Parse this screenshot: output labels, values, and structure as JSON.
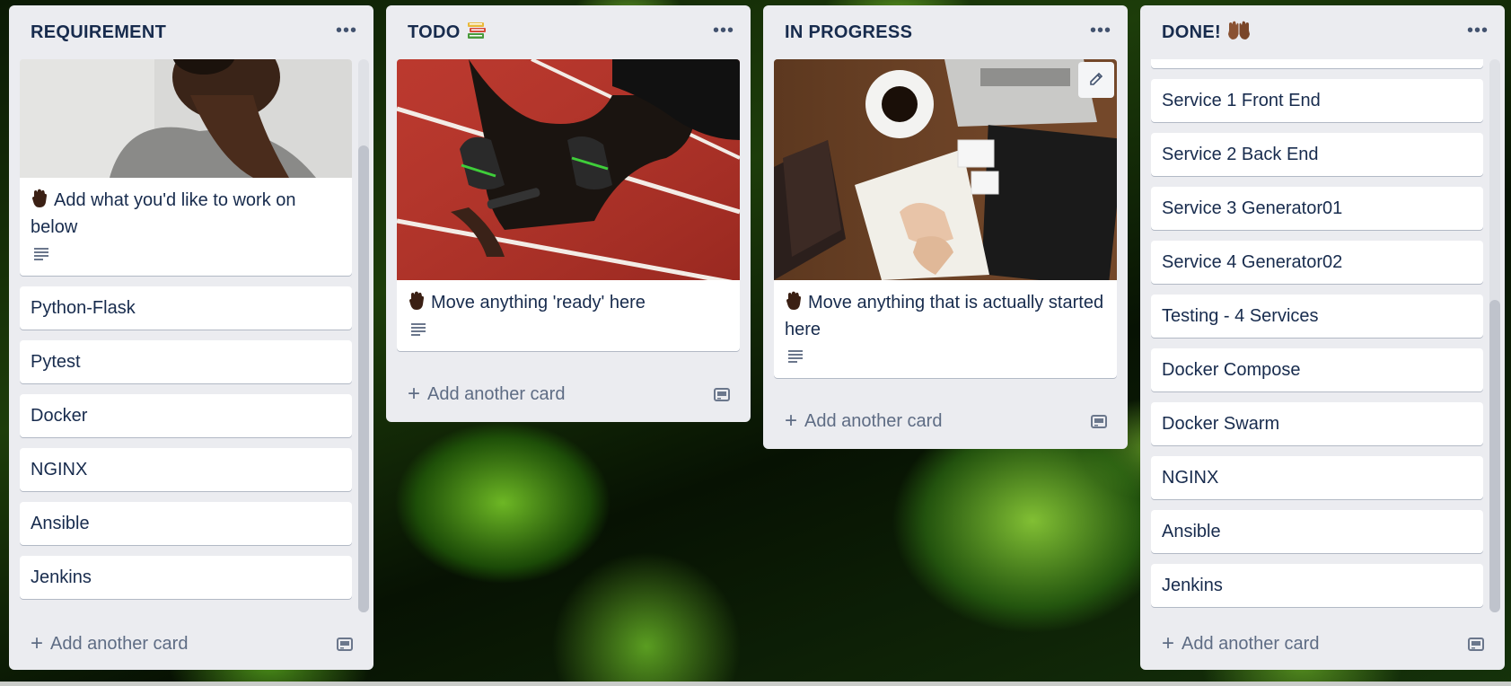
{
  "lists": [
    {
      "title": "REQUIREMENT",
      "intro_card": "Add what you'd like to work on below",
      "cards": [
        "Python-Flask",
        "Pytest",
        "Docker",
        "NGINX",
        "Ansible",
        "Jenkins"
      ],
      "add_label": "Add another card"
    },
    {
      "title": "TODO",
      "intro_card": "Move anything 'ready' here",
      "add_label": "Add another card"
    },
    {
      "title": "IN PROGRESS",
      "intro_card": "Move anything that is actually started here",
      "add_label": "Add another card"
    },
    {
      "title": "DONE!",
      "cards": [
        "Service 1 Front End",
        "Service 2 Back End",
        "Service 3 Generator01",
        "Service 4 Generator02",
        "Testing - 4 Services",
        "Docker Compose",
        "Docker Swarm",
        "NGINX",
        "Ansible",
        "Jenkins"
      ],
      "add_label": "Add another card"
    }
  ],
  "icons": {
    "list_menu": "ellipsis-icon",
    "description": "description-icon",
    "template": "card-template-icon",
    "add": "plus-icon",
    "edit": "pencil-icon",
    "hand": "raised-hand-emoji"
  },
  "colors": {
    "list_bg": "#ebecf0",
    "card_bg": "#ffffff",
    "text": "#172b4d",
    "muted": "#5e6c84"
  }
}
